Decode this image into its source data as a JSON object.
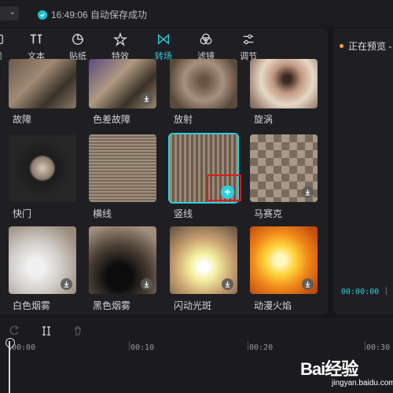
{
  "topbar": {
    "save_status": "16:49:06 自动保存成功"
  },
  "toolbar": {
    "items": [
      {
        "label": "频",
        "icon": "media-icon",
        "active": false
      },
      {
        "label": "文本",
        "icon": "text-icon",
        "active": false
      },
      {
        "label": "贴纸",
        "icon": "sticker-icon",
        "active": false
      },
      {
        "label": "特效",
        "icon": "effects-icon",
        "active": false
      },
      {
        "label": "转场",
        "icon": "transition-icon",
        "active": true
      },
      {
        "label": "滤镜",
        "icon": "filter-icon",
        "active": false
      },
      {
        "label": "调节",
        "icon": "adjust-icon",
        "active": false
      }
    ]
  },
  "transitions": [
    {
      "name": "故障",
      "download": false
    },
    {
      "name": "色差故障",
      "download": true
    },
    {
      "name": "放射",
      "download": false
    },
    {
      "name": "旋涡",
      "download": false
    },
    {
      "name": "快门",
      "download": false
    },
    {
      "name": "横线",
      "download": false
    },
    {
      "name": "竖线",
      "download": false,
      "selected": true
    },
    {
      "name": "马赛克",
      "download": true
    },
    {
      "name": "白色烟雾",
      "download": true
    },
    {
      "name": "黑色烟雾",
      "download": true
    },
    {
      "name": "闪动光斑",
      "download": true
    },
    {
      "name": "动漫火焰",
      "download": true
    }
  ],
  "preview": {
    "title": "正在预览 -",
    "time": "00:00:00"
  },
  "timeline": {
    "ticks": [
      "00:00",
      "00:10",
      "00:20",
      "00:30"
    ]
  },
  "watermark": {
    "brand": "Bai经验",
    "url": "jingyan.baidu.com"
  },
  "colors": {
    "accent": "#2ccfe0",
    "highlight_box": "#e01818"
  }
}
